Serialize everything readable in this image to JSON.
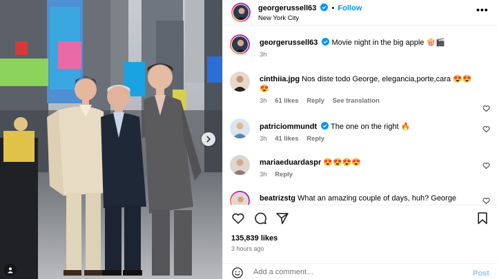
{
  "header": {
    "username": "georgerussell63",
    "separator": "•",
    "follow_label": "Follow",
    "location": "New York City",
    "more_label": "•••"
  },
  "caption": {
    "username": "georgerussell63",
    "text": "Movie night in the big apple 🍿🎬",
    "time": "3h"
  },
  "comments": [
    {
      "username": "cinthiia.jpg",
      "text": "Nos diste todo George, elegancia,porte,cara 😍😍😍",
      "time": "3h",
      "likes": "61 likes",
      "reply": "Reply",
      "translate": "See translation"
    },
    {
      "username": "patriciommundt",
      "verified": true,
      "text": "The one on the right 🔥",
      "time": "3h",
      "likes": "41 likes",
      "reply": "Reply"
    },
    {
      "username": "mariaeduardaspr",
      "text": "😍😍😍😍",
      "time": "3h",
      "reply": "Reply"
    },
    {
      "username": "beatrizstg",
      "text": "What an amazing couple of days, huh? George",
      "time": "",
      "reply": ""
    }
  ],
  "actions": {
    "likes": "135,839 likes",
    "time": "3 hours ago"
  },
  "comment_box": {
    "placeholder": "Add a comment…",
    "post_label": "Post"
  },
  "colors": {
    "accent": "#0095f6",
    "post_disabled": "#84c8f8",
    "meta_text": "#737373",
    "heart_red": "#ed4956"
  },
  "icons": {
    "photo_next": "chevron-right-icon",
    "photo_tag": "user-tag-icon",
    "like": "heart-icon",
    "comment": "comment-icon",
    "share": "paper-plane-icon",
    "save": "bookmark-icon",
    "emoji": "emoji-icon",
    "more": "more-options-icon"
  }
}
